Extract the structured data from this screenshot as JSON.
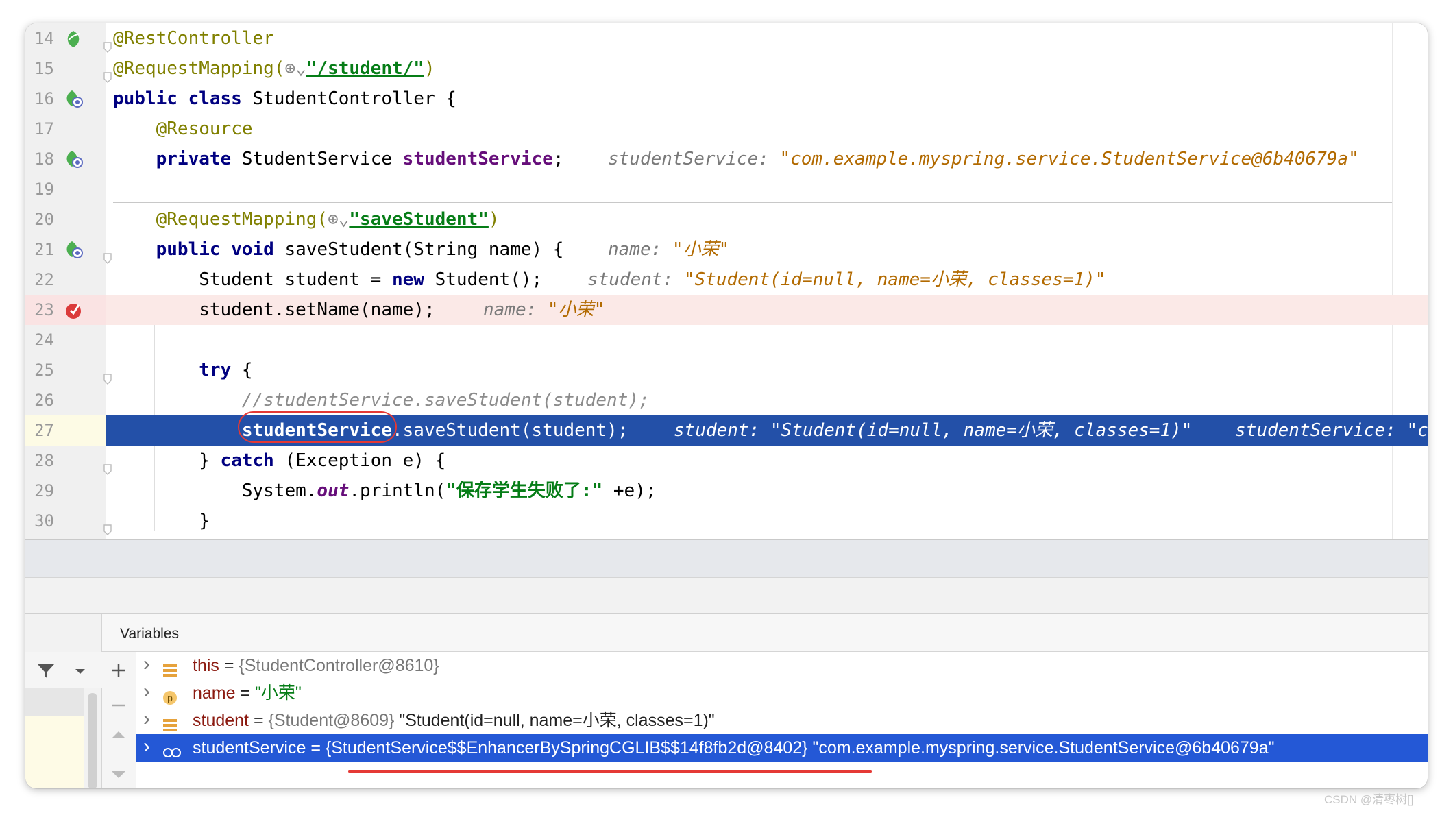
{
  "editor": {
    "lines": [
      {
        "num": "14",
        "parts": [
          [
            "ann",
            "@RestController"
          ]
        ]
      },
      {
        "num": "15",
        "parts": [
          [
            "ann",
            "@RequestMapping("
          ],
          [
            "gray",
            "⊕⌄"
          ],
          [
            "strlink",
            "\"/student/\""
          ],
          [
            "ann",
            ")"
          ]
        ]
      },
      {
        "num": "16",
        "parts": [
          [
            "kw",
            "public class "
          ],
          [
            "plain",
            "StudentController {"
          ]
        ]
      },
      {
        "num": "17",
        "parts": [
          [
            "plain",
            "    "
          ],
          [
            "ann",
            "@Resource"
          ]
        ]
      },
      {
        "num": "18",
        "parts": [
          [
            "plain",
            "    "
          ],
          [
            "kw",
            "private "
          ],
          [
            "plain",
            "StudentService "
          ],
          [
            "fld",
            "studentService"
          ],
          [
            "plain",
            ";"
          ]
        ],
        "hint": [
          [
            "hint",
            "studentService: "
          ],
          [
            "hintv",
            "\"com.example.myspring.service.StudentService@6b40679a\""
          ]
        ]
      },
      {
        "num": "19",
        "parts": []
      },
      {
        "num": "20",
        "parts": [
          [
            "plain",
            "    "
          ],
          [
            "ann",
            "@RequestMapping("
          ],
          [
            "gray",
            "⊕⌄"
          ],
          [
            "strlink",
            "\"saveStudent\""
          ],
          [
            "ann",
            ")"
          ]
        ]
      },
      {
        "num": "21",
        "parts": [
          [
            "plain",
            "    "
          ],
          [
            "kw",
            "public void "
          ],
          [
            "plain",
            "saveStudent(String name) {"
          ]
        ],
        "hint": [
          [
            "hint",
            "name: "
          ],
          [
            "hintv",
            "\"小荣\""
          ]
        ]
      },
      {
        "num": "22",
        "parts": [
          [
            "plain",
            "        Student student = "
          ],
          [
            "kw",
            "new "
          ],
          [
            "plain",
            "Student();"
          ]
        ],
        "hint": [
          [
            "hint",
            "student: "
          ],
          [
            "hintv",
            "\"Student(id=null, name=小荣, classes=1)\""
          ]
        ]
      },
      {
        "num": "23",
        "parts": [
          [
            "plain",
            "        student.setName(name);"
          ]
        ],
        "hint": [
          [
            "hint",
            "name: "
          ],
          [
            "hintv",
            "\"小荣\""
          ]
        ]
      },
      {
        "num": "24",
        "parts": []
      },
      {
        "num": "25",
        "parts": [
          [
            "plain",
            "        "
          ],
          [
            "kw",
            "try "
          ],
          [
            "plain",
            "{"
          ]
        ]
      },
      {
        "num": "26",
        "parts": [
          [
            "plain",
            "            "
          ],
          [
            "cmt",
            "//studentService.saveStudent(student);"
          ]
        ]
      },
      {
        "num": "27",
        "parts": [
          [
            "plain",
            "            "
          ],
          [
            "kwb",
            "studentService"
          ],
          [
            "plain",
            ".saveStudent(student);"
          ]
        ],
        "hint": [
          [
            "hint",
            "student: "
          ],
          [
            "hintv",
            "\"Student(id=null, name=小荣, classes=1)\""
          ],
          [
            "hint",
            "    studentService: \"com"
          ]
        ]
      },
      {
        "num": "28",
        "parts": [
          [
            "plain",
            "        } "
          ],
          [
            "kw",
            "catch "
          ],
          [
            "plain",
            "(Exception e) {"
          ]
        ]
      },
      {
        "num": "29",
        "parts": [
          [
            "plain",
            "            System."
          ],
          [
            "stat",
            "out"
          ],
          [
            "plain",
            ".println("
          ],
          [
            "str",
            "\"保存学生失败了:\""
          ],
          [
            "plain",
            " +e);"
          ]
        ]
      },
      {
        "num": "30",
        "parts": [
          [
            "plain",
            "        }"
          ]
        ]
      }
    ]
  },
  "debugger": {
    "panel_title": "Variables",
    "variables": [
      {
        "icon": "field-icon",
        "name": "this",
        "eq": " = ",
        "value": "{StudentController@8610}",
        "extra": ""
      },
      {
        "icon": "parameter-icon",
        "name": "name",
        "eq": " = ",
        "value": "\"小荣\"",
        "extra": ""
      },
      {
        "icon": "field-icon",
        "name": "student",
        "eq": " = ",
        "value": "{Student@8609}",
        "extra": " \"Student(id=null, name=小荣, classes=1)\""
      },
      {
        "icon": "watch-icon",
        "name": "studentService",
        "eq": " = ",
        "value": "{StudentService$$EnhancerBySpringCGLIB$$14f8fb2d@8402}",
        "extra": " \"com.example.myspring.service.StudentService@6b40679a\""
      }
    ]
  },
  "watermark": "CSDN @清枣树[]"
}
